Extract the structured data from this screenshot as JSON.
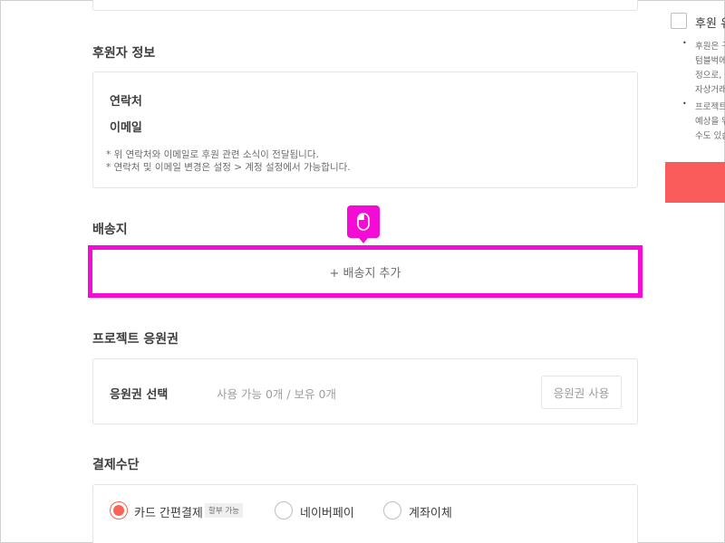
{
  "sponsor_info": {
    "title": "후원자 정보",
    "contact_label": "연락처",
    "email_label": "이메일",
    "notes": [
      "* 위 연락처와 이메일로 후원 관련 소식이 전달됩니다.",
      "* 연락처 및 이메일 변경은 설정 > 계정 설정에서 가능합니다."
    ]
  },
  "shipping": {
    "title": "배송지",
    "add_button_label": "+ 배송지 추가"
  },
  "coupon": {
    "title": "프로젝트 응원권",
    "select_label": "응원권 선택",
    "availability": "사용 가능 0개 / 보유 0개",
    "use_button_label": "응원권 사용"
  },
  "payment": {
    "title": "결제수단",
    "methods": [
      {
        "label": "카드 간편결제",
        "badge": "할부 가능",
        "selected": true
      },
      {
        "label": "네이버페이",
        "selected": false
      },
      {
        "label": "계좌이체",
        "selected": false
      }
    ]
  },
  "right_panel": {
    "agree_label": "후원 유",
    "lines": [
      "후원은 구",
      "텀블벅에",
      "정으로,",
      "자상거래",
      "프로젝트",
      "예상을 뛰",
      "수도 있습"
    ]
  },
  "icons": {
    "cursor_marker": "mouse-icon"
  },
  "colors": {
    "highlight": "#f40cd6",
    "accent": "#f86453",
    "pay_button": "#fa5b5b"
  }
}
